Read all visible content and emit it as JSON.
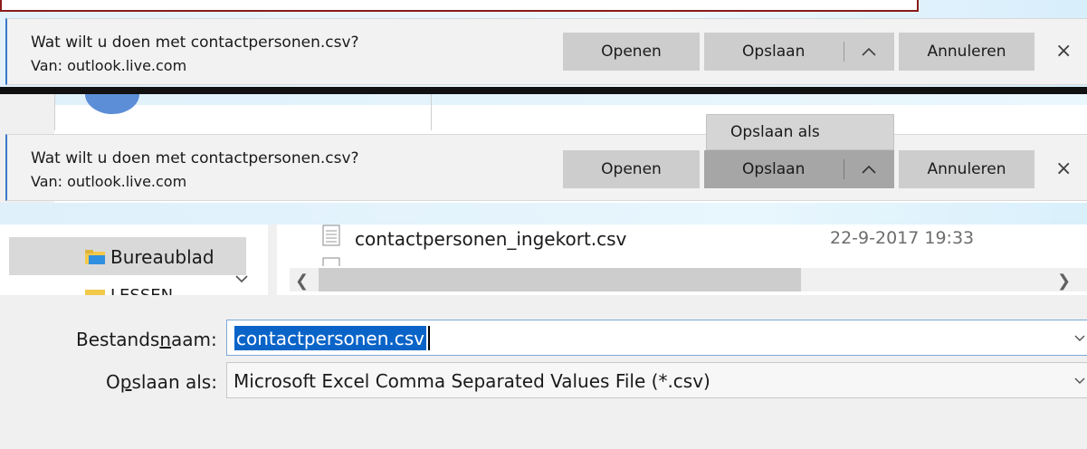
{
  "download_bar": {
    "question": "Wat wilt u doen met contactpersonen.csv?",
    "source": "Van: outlook.live.com",
    "open_label": "Openen",
    "save_label": "Opslaan",
    "cancel_label": "Annuleren",
    "close_glyph": "×"
  },
  "save_menu": {
    "save_as_label": "Opslaan als"
  },
  "file_dialog": {
    "nav_selected": "Bureaublad",
    "nav_next_partial": "LESSEN",
    "file_name": "contactpersonen_ingekort.csv",
    "file_date": "22-9-2017 19:33",
    "filename_label_pre": "Bestands",
    "filename_label_u": "n",
    "filename_label_post": "aam:",
    "filename_value": "contactpersonen.csv",
    "savetype_label_pre": "O",
    "savetype_label_u": "p",
    "savetype_label_post": "slaan als:",
    "savetype_value": "Microsoft Excel Comma Separated Values File (*.csv)"
  },
  "icons": [
    "close-icon",
    "chevron-up-icon",
    "folder-icon",
    "file-icon",
    "chevron-down-icon",
    "scroll-left-icon",
    "scroll-right-icon"
  ],
  "colors": {
    "accent": "#0a64c8",
    "bar_border": "#3a78c8",
    "button_bg": "#cdcdcd",
    "button_pressed": "#a6a6a6",
    "frame_red": "#8b1a1a"
  }
}
